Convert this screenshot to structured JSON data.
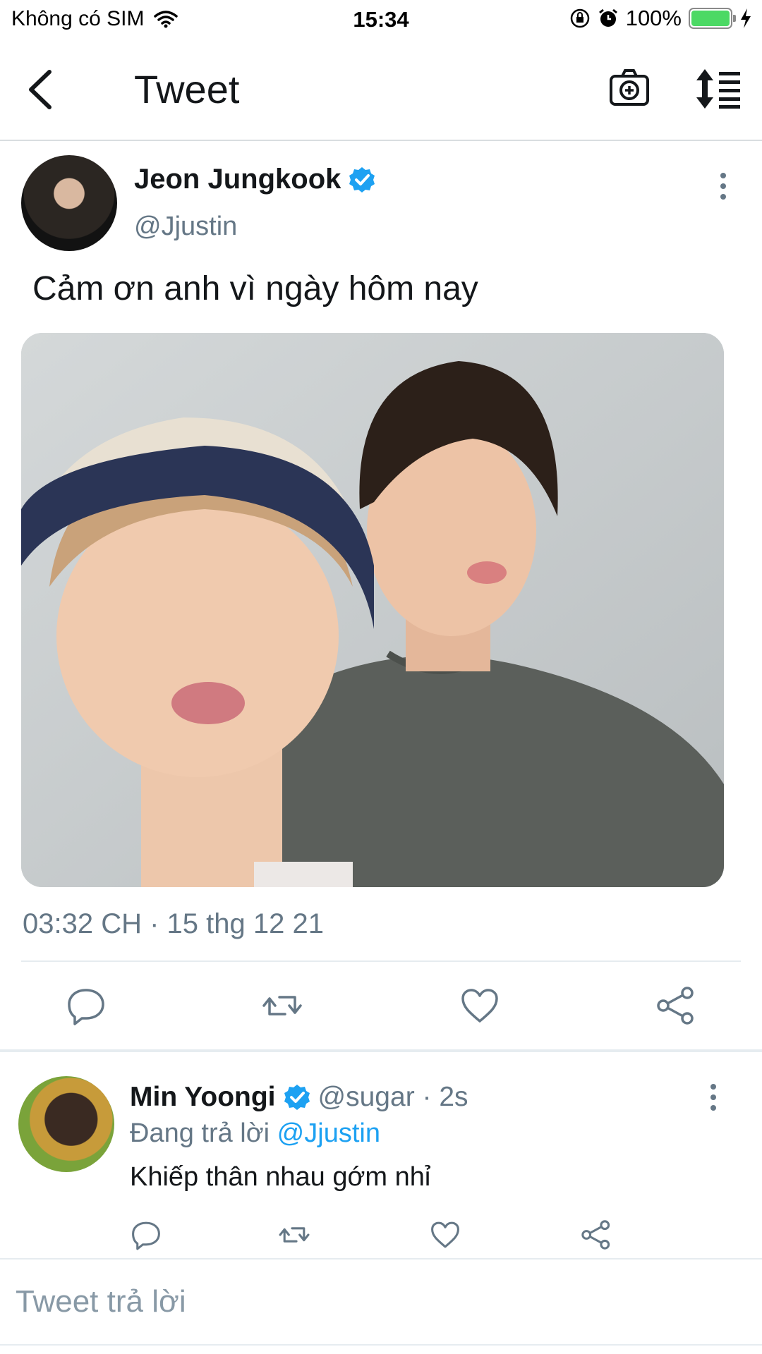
{
  "status_bar": {
    "carrier": "Không có SIM",
    "time": "15:34",
    "battery": "100%",
    "icons": [
      "wifi-icon",
      "rotation-lock-icon",
      "alarm-icon",
      "battery-icon",
      "charging-icon"
    ]
  },
  "header": {
    "title": "Tweet",
    "icons": [
      "back-icon",
      "camera-add-icon",
      "sort-icon"
    ]
  },
  "tweet": {
    "author_name": "Jeon Jungkook",
    "author_handle": "@Jjustin",
    "text": "Cảm ơn anh vì ngày hôm nay",
    "timestamp": "03:32 CH · 15 thg 12 21",
    "actions": [
      "reply-icon",
      "retweet-icon",
      "like-icon",
      "share-icon"
    ]
  },
  "reply": {
    "author_name": "Min Yoongi",
    "author_handle_time": "@sugar · 2s",
    "replying_prefix": "Đang trả lời",
    "replying_to": "@Jjustin",
    "text": "Khiếp thân nhau gớm nhỉ",
    "actions": [
      "reply-icon",
      "retweet-icon",
      "like-icon",
      "share-icon"
    ]
  },
  "composer": {
    "placeholder": "Tweet trả lời"
  },
  "colors": {
    "accent": "#1da1f2",
    "secondary_text": "#657786",
    "icon_gray": "#657786",
    "battery_green": "#4cd964"
  }
}
